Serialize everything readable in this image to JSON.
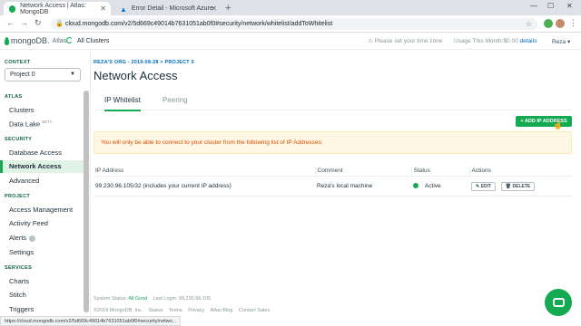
{
  "browser": {
    "tabs": [
      {
        "title": "Network Access | Atlas: MongoDB",
        "active": true
      },
      {
        "title": "Error Detail - Microsoft Azure",
        "active": false
      }
    ],
    "url": "cloud.mongodb.com/v2/5d669c49014b7631051ab0f0#security/network/whitelist/addToWhitelist",
    "status_url": "https://cloud.mongodb.com/v2/5d669c49014b7631051ab0f0#security/netwo..."
  },
  "header": {
    "logo": "mongoDB.",
    "product": "Atlas",
    "org_link": "All Clusters",
    "timezone_warning": "Please set your time zone",
    "usage_label": "Usage This Month:",
    "usage_value": "$0.00",
    "details": "details",
    "user": "Reza"
  },
  "sidebar": {
    "context_label": "CONTEXT",
    "project": "Project 0",
    "sections": [
      {
        "title": "ATLAS",
        "items": [
          "Clusters",
          "Data Lake"
        ]
      },
      {
        "title": "SECURITY",
        "items": [
          "Database Access",
          "Network Access",
          "Advanced"
        ]
      },
      {
        "title": "PROJECT",
        "items": [
          "Access Management",
          "Activity Feed",
          "Alerts",
          "Settings"
        ]
      },
      {
        "title": "SERVICES",
        "items": [
          "Charts",
          "Stitch",
          "Triggers"
        ]
      }
    ],
    "data_lake_badge": "BETA",
    "active_item": "Network Access"
  },
  "main": {
    "breadcrumb": "REZA'S ORG - 2019-08-28 > PROJECT 0",
    "title": "Network Access",
    "tabs": [
      "IP Whitelist",
      "Peering"
    ],
    "add_button": "+ ADD IP ADDRESS",
    "notice": "You will only be able to connect to your cluster from the following list of IP Addresses:",
    "table": {
      "headers": [
        "IP Address",
        "Comment",
        "Status",
        "Actions"
      ],
      "rows": [
        {
          "ip": "99.230.96.105/32  (includes your current IP address)",
          "comment": "Reza's local machine",
          "status": "Active",
          "edit": "✎ EDIT",
          "delete": "🗑 DELETE"
        }
      ]
    }
  },
  "footer": {
    "system_status_label": "System Status:",
    "system_status": "All Good",
    "last_login": "Last Login: 99.230.96.105",
    "copyright": "©2019 MongoDB, Inc.",
    "links": [
      "Status",
      "Terms",
      "Privacy",
      "Atlas Blog",
      "Contact Sales"
    ]
  },
  "colors": {
    "brand": "#13aa52",
    "link": "#006cbc",
    "warning": "#e04a00"
  },
  "icons": [
    "lock-icon",
    "star-icon",
    "chat-icon",
    "warning-icon",
    "pencil-icon",
    "trash-icon"
  ]
}
